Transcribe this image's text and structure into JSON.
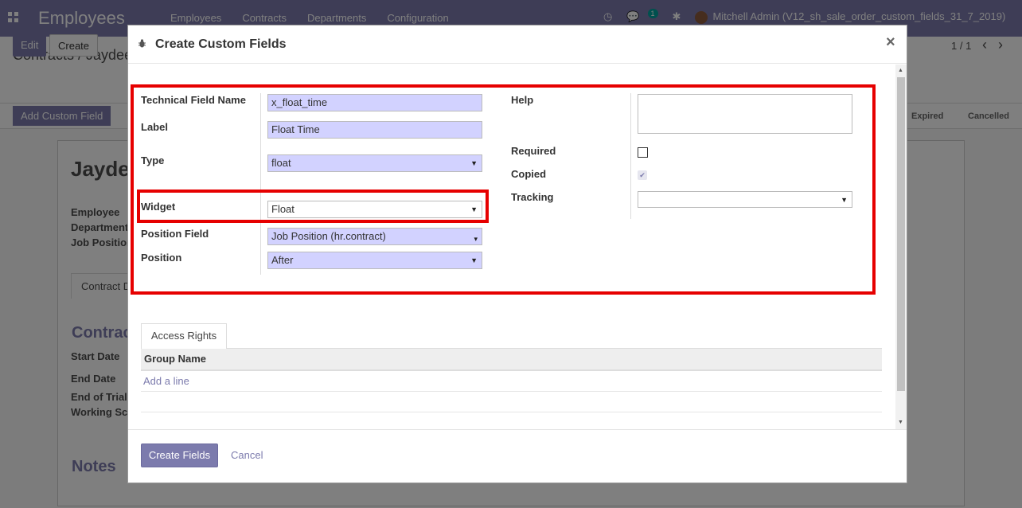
{
  "navbar": {
    "app_name": "Employees",
    "menu": [
      "Employees",
      "Contracts",
      "Departments",
      "Configuration"
    ],
    "message_count": "1",
    "user": "Mitchell Admin (V12_sh_sale_order_custom_fields_31_7_2019)"
  },
  "control_panel": {
    "breadcrumb": "Contracts / Jaydee",
    "edit": "Edit",
    "create": "Create",
    "pager": "1 / 1",
    "add_custom_field": "Add Custom Field",
    "stages": [
      "Expired",
      "Cancelled"
    ]
  },
  "form_background": {
    "title": "Jayde",
    "labels": [
      "Employee",
      "Department",
      "Job Position"
    ],
    "tab": "Contract D",
    "section": "Contrac",
    "fields": [
      "Start Date",
      "End Date",
      "End of Trial",
      "Working Sc"
    ],
    "notes": "Notes"
  },
  "modal": {
    "title": "Create Custom Fields",
    "close": "×",
    "left": {
      "technical_name_label": "Technical Field Name",
      "technical_name_value": "x_float_time",
      "label_label": "Label",
      "label_value": "Float Time",
      "type_label": "Type",
      "type_value": "float",
      "widget_label": "Widget",
      "widget_value": "Float",
      "position_field_label": "Position Field",
      "position_field_value": "Job Position (hr.contract)",
      "position_label": "Position",
      "position_value": "After"
    },
    "right": {
      "help_label": "Help",
      "help_value": "",
      "required_label": "Required",
      "required_checked": false,
      "copied_label": "Copied",
      "copied_checked": true,
      "tracking_label": "Tracking",
      "tracking_value": ""
    },
    "tabs": [
      "Access Rights"
    ],
    "grid": {
      "header": "Group Name",
      "add_line": "Add a line"
    },
    "footer": {
      "create": "Create Fields",
      "cancel": "Cancel"
    }
  },
  "highlight_color": "#e60000",
  "accent_color": "#7c7bad"
}
